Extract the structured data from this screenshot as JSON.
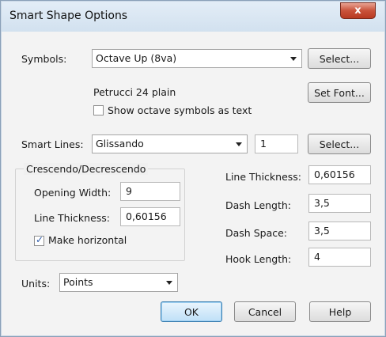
{
  "window": {
    "title": "Smart Shape Options",
    "close_glyph": "x"
  },
  "symbols": {
    "label": "Symbols:",
    "selected": "Octave Up (8va)",
    "select_button": "Select...",
    "font_text": "Petrucci 24 plain",
    "set_font_button": "Set Font...",
    "show_octave_label": "Show octave symbols as text",
    "show_octave_checked": false
  },
  "smart_lines": {
    "label": "Smart Lines:",
    "selected": "Glissando",
    "number_value": "1",
    "select_button": "Select..."
  },
  "crescendo": {
    "group_label": "Crescendo/Decrescendo",
    "opening_width_label": "Opening Width:",
    "opening_width_value": "9",
    "line_thickness_label": "Line Thickness:",
    "line_thickness_value": "0,60156",
    "make_horizontal_label": "Make horizontal",
    "make_horizontal_checked": true
  },
  "lines": {
    "line_thickness_label": "Line Thickness:",
    "line_thickness_value": "0,60156",
    "dash_length_label": "Dash Length:",
    "dash_length_value": "3,5",
    "dash_space_label": "Dash Space:",
    "dash_space_value": "3,5",
    "hook_length_label": "Hook Length:",
    "hook_length_value": "4"
  },
  "units": {
    "label": "Units:",
    "selected": "Points"
  },
  "footer": {
    "ok": "OK",
    "cancel": "Cancel",
    "help": "Help"
  }
}
